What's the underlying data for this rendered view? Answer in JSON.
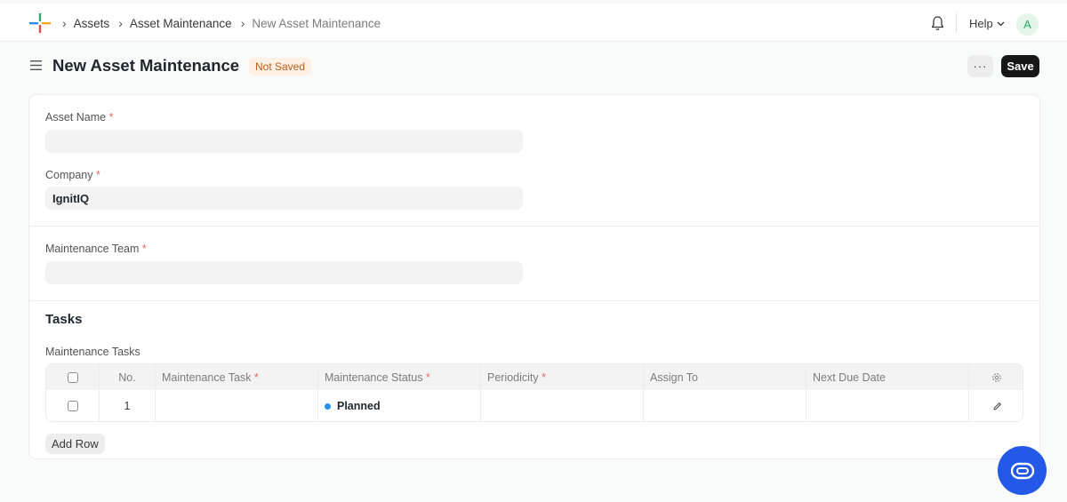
{
  "navbar": {
    "breadcrumbs": [
      "Assets",
      "Asset Maintenance",
      "New Asset Maintenance"
    ],
    "help_label": "Help",
    "avatar_initial": "A"
  },
  "page": {
    "title": "New Asset Maintenance",
    "status": "Not Saved",
    "more_label": "···",
    "save_label": "Save"
  },
  "form": {
    "asset_name": {
      "label": "Asset Name",
      "value": ""
    },
    "company": {
      "label": "Company",
      "value": "IgnitIQ"
    },
    "maintenance_team": {
      "label": "Maintenance Team",
      "value": ""
    },
    "required_mark": "*",
    "tasks_section": {
      "title": "Tasks",
      "table_label": "Maintenance Tasks",
      "columns": [
        "No.",
        "Maintenance Task",
        "Maintenance Status",
        "Periodicity",
        "Assign To",
        "Next Due Date"
      ],
      "rows": [
        {
          "no": "1",
          "maintenance_task": "",
          "maintenance_status": "Planned",
          "periodicity": "",
          "assign_to": "",
          "next_due_date": ""
        }
      ],
      "add_row_label": "Add Row"
    }
  },
  "colors": {
    "accent": "#2490ef",
    "save_button": "#171717",
    "not_saved_badge": "#c05c18",
    "chat_fab": "#2458e6"
  }
}
